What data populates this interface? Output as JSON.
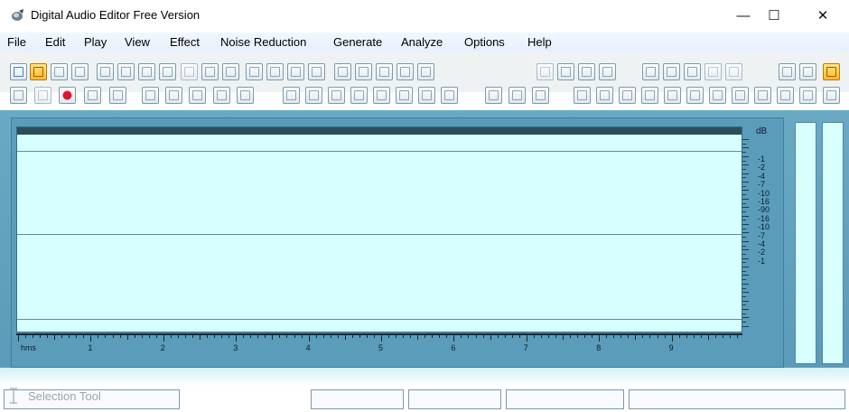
{
  "window": {
    "title": "Digital Audio Editor Free Version",
    "controls": {
      "minimize": "—",
      "maximize": "☐",
      "close": "✕"
    }
  },
  "menu": [
    {
      "label": "File"
    },
    {
      "label": "Edit"
    },
    {
      "label": "Play"
    },
    {
      "label": "View"
    },
    {
      "label": "Effect"
    },
    {
      "label": "Noise Reduction"
    },
    {
      "label": "Generate"
    },
    {
      "label": "Analyze"
    },
    {
      "label": "Options"
    },
    {
      "label": "Help"
    }
  ],
  "toolbar": {
    "row1_icons": [
      "new-file",
      "open-folder",
      "save",
      "save-as",
      "undo",
      "redo",
      "repeat",
      "copy",
      "cut",
      "paste",
      "paste-new",
      "selection-cursor",
      "select-all",
      "print",
      "dropdown",
      "fade-in",
      "fade-out",
      "crossfade",
      "silence",
      "normalize",
      "brightness",
      "equalizer",
      "trim-start",
      "trim-end",
      "marker",
      "cd",
      "record-input",
      "echo",
      "reverb",
      "zoom-fit",
      "zoom-sel",
      "settings"
    ],
    "row2_icons": [
      "play",
      "loop",
      "record",
      "pause",
      "stop",
      "go-start",
      "prev",
      "play-sel",
      "next",
      "go-end",
      "zoom-in",
      "zoom-out",
      "zoom-h-in",
      "zoom-h-out",
      "zoom-v-in",
      "zoom-v-out",
      "zoom-all",
      "zoom-prev",
      "convert",
      "reverse",
      "flatten",
      "pitch-up",
      "pitch-down",
      "tempo",
      "volume",
      "wah",
      "chorus",
      "flanger",
      "distortion",
      "compressor",
      "limiter",
      "gate"
    ]
  },
  "accent": {
    "record": "#e8102b",
    "highlight": "#ffb72a",
    "wave_bg": "#d8ffff",
    "panel": "#5b9bb9"
  },
  "db_scale": {
    "unit": "dB",
    "labels": [
      "-1",
      "-2",
      "-4",
      "-7",
      "-10",
      "-16",
      "-90",
      "-16",
      "-10",
      "-7",
      "-4",
      "-2",
      "-1"
    ]
  },
  "ruler": {
    "unit": "hms",
    "labels": [
      "1",
      "2",
      "3",
      "4",
      "5",
      "6",
      "7",
      "8",
      "9"
    ]
  },
  "status": {
    "tool": "Selection Tool"
  }
}
